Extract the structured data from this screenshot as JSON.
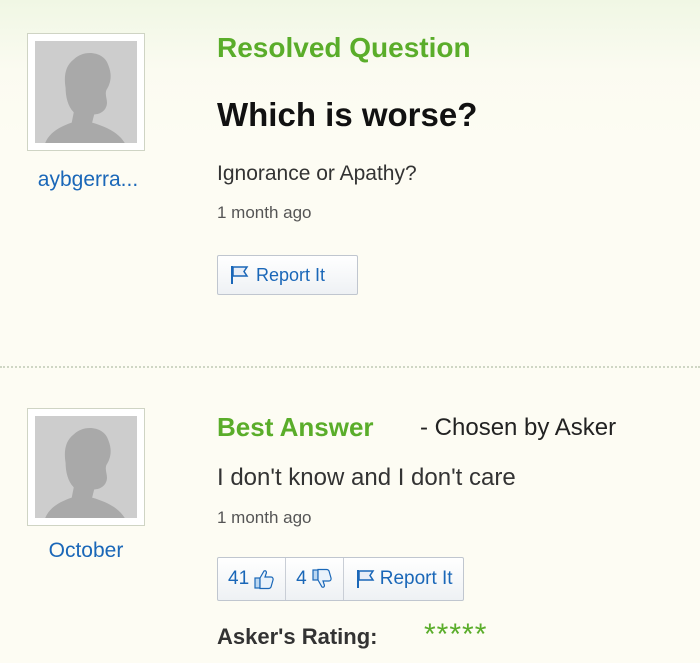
{
  "question": {
    "status": "Resolved Question",
    "title": "Which is worse?",
    "body": "Ignorance or Apathy?",
    "time": "1 month ago",
    "asker": "aybgerra...",
    "report_label": "Report It"
  },
  "answer": {
    "heading": "Best Answer",
    "chosen_by": "- Chosen by Asker",
    "body": "I don't know and I don't care",
    "time": "1 month ago",
    "answerer": "October",
    "thumbs_up_count": "41",
    "thumbs_down_count": "4",
    "report_label": "Report It",
    "rating_label": "Asker's Rating:",
    "rating_stars": "*****",
    "rating_value": 5
  },
  "colors": {
    "accent_green": "#5aad2a",
    "link_blue": "#1a67b8"
  },
  "icons": {
    "avatar": "user-silhouette-icon",
    "report": "flag-icon",
    "thumbs_up": "thumbs-up-icon",
    "thumbs_down": "thumbs-down-icon"
  }
}
